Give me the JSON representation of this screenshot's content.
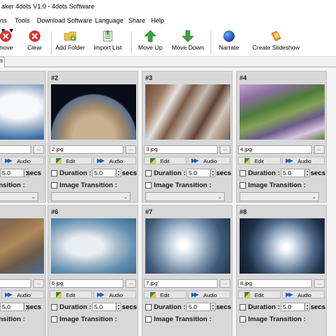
{
  "window": {
    "title": "aker 4dots V1.0 - 4dots Software"
  },
  "menu": [
    "ns",
    "Tools",
    "Download Software",
    "Language",
    "Share",
    "Help"
  ],
  "toolbar": {
    "remove": "move",
    "clear": "Clear",
    "add_folder": "Add Folder",
    "import_list": "Import List",
    "move_up": "Move Up",
    "move_down": "Move Down",
    "narrate": "Narrate",
    "create_slideshow": "Create Slideshow"
  },
  "tab": {
    "label": "s"
  },
  "slide_common": {
    "edit": "Edit",
    "audio": "Audio",
    "duration_label": "Duration :",
    "duration_value": "5.0",
    "secs": "secs",
    "image_transition": "Image Transition :",
    "dots": "..."
  },
  "slides": [
    {
      "num": "",
      "file": ""
    },
    {
      "num": "#2",
      "file": "2.jpg"
    },
    {
      "num": "#3",
      "file": "3.jpg"
    },
    {
      "num": "#4",
      "file": "4.jpg"
    },
    {
      "num": "",
      "file": ""
    },
    {
      "num": "#6",
      "file": "6.jpg"
    },
    {
      "num": "#7",
      "file": "7.jpg"
    },
    {
      "num": "#8",
      "file": "8.jpg"
    }
  ],
  "colors": {
    "accent": "#1d5fbf",
    "card_bg": "#d8d8d8"
  }
}
